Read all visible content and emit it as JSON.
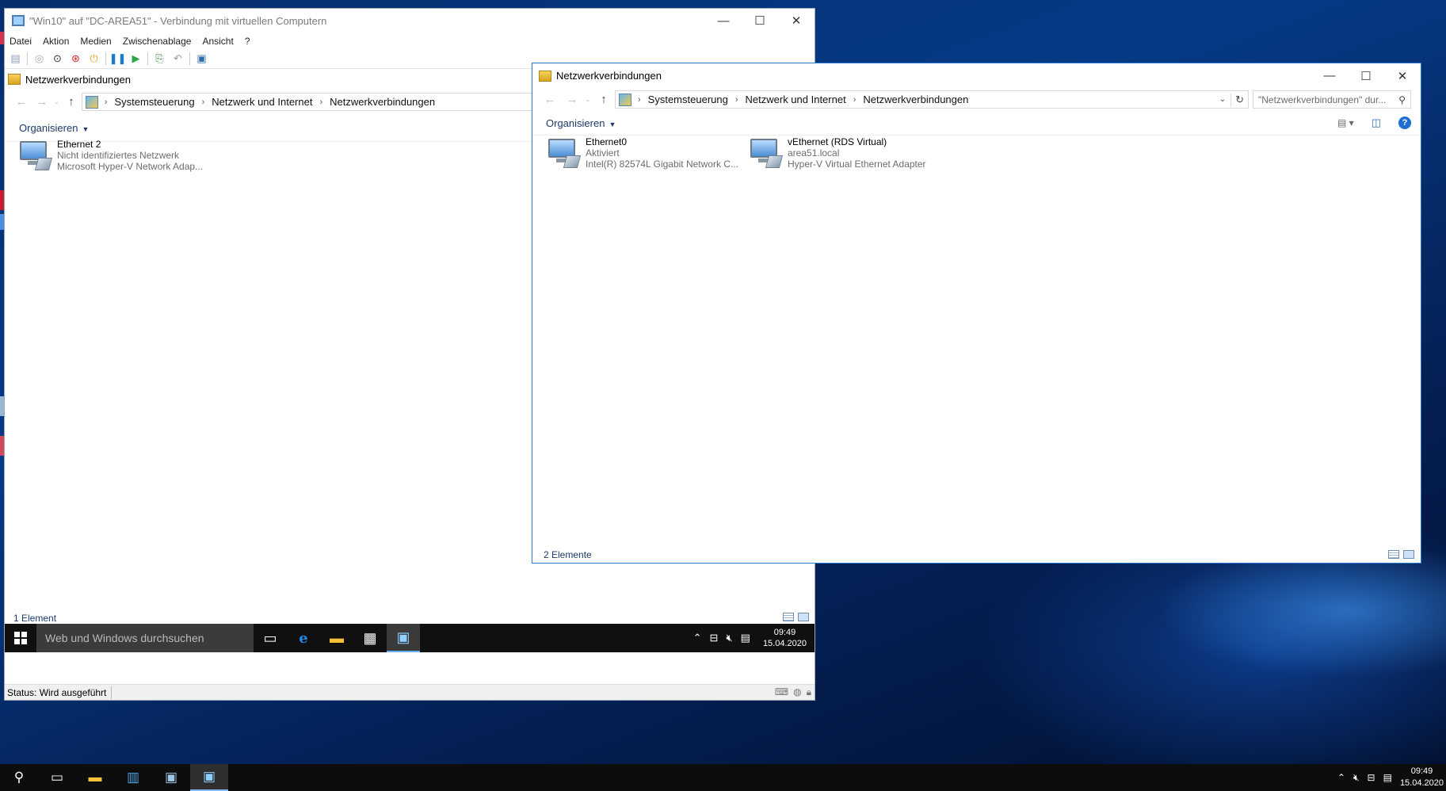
{
  "vm_window": {
    "title": "\"Win10\" auf \"DC-AREA51\" - Verbindung mit virtuellen Computern",
    "menu": [
      "Datei",
      "Aktion",
      "Medien",
      "Zwischenablage",
      "Ansicht",
      "?"
    ],
    "status": "Status: Wird ausgeführt"
  },
  "guest_explorer": {
    "title": "Netzwerkverbindungen",
    "breadcrumb": [
      "Systemsteuerung",
      "Netzwerk und Internet",
      "Netzwerkverbindungen"
    ],
    "organize_label": "Organisieren",
    "items": [
      {
        "name": "Ethernet 2",
        "status": "Nicht identifiziertes Netzwerk",
        "device": "Microsoft Hyper-V Network Adap..."
      }
    ],
    "item_count": "1 Element"
  },
  "guest_taskbar": {
    "search_placeholder": "Web und Windows durchsuchen",
    "time": "09:49",
    "date": "15.04.2020"
  },
  "host_explorer": {
    "title": "Netzwerkverbindungen",
    "breadcrumb": [
      "Systemsteuerung",
      "Netzwerk und Internet",
      "Netzwerkverbindungen"
    ],
    "search_placeholder": "\"Netzwerkverbindungen\" dur...",
    "organize_label": "Organisieren",
    "items": [
      {
        "name": "Ethernet0",
        "status": "Aktiviert",
        "device": "Intel(R) 82574L Gigabit Network C..."
      },
      {
        "name": "vEthernet (RDS Virtual)",
        "status": "area51.local",
        "device": "Hyper-V Virtual Ethernet Adapter"
      }
    ],
    "item_count": "2 Elemente"
  },
  "host_taskbar": {
    "time": "09:49",
    "date": "15.04.2020"
  },
  "icons": {
    "back": "arrow-left-icon",
    "forward": "arrow-right-icon",
    "up": "arrow-up-icon",
    "refresh": "refresh-icon",
    "search": "search-icon",
    "help": "help-icon"
  }
}
